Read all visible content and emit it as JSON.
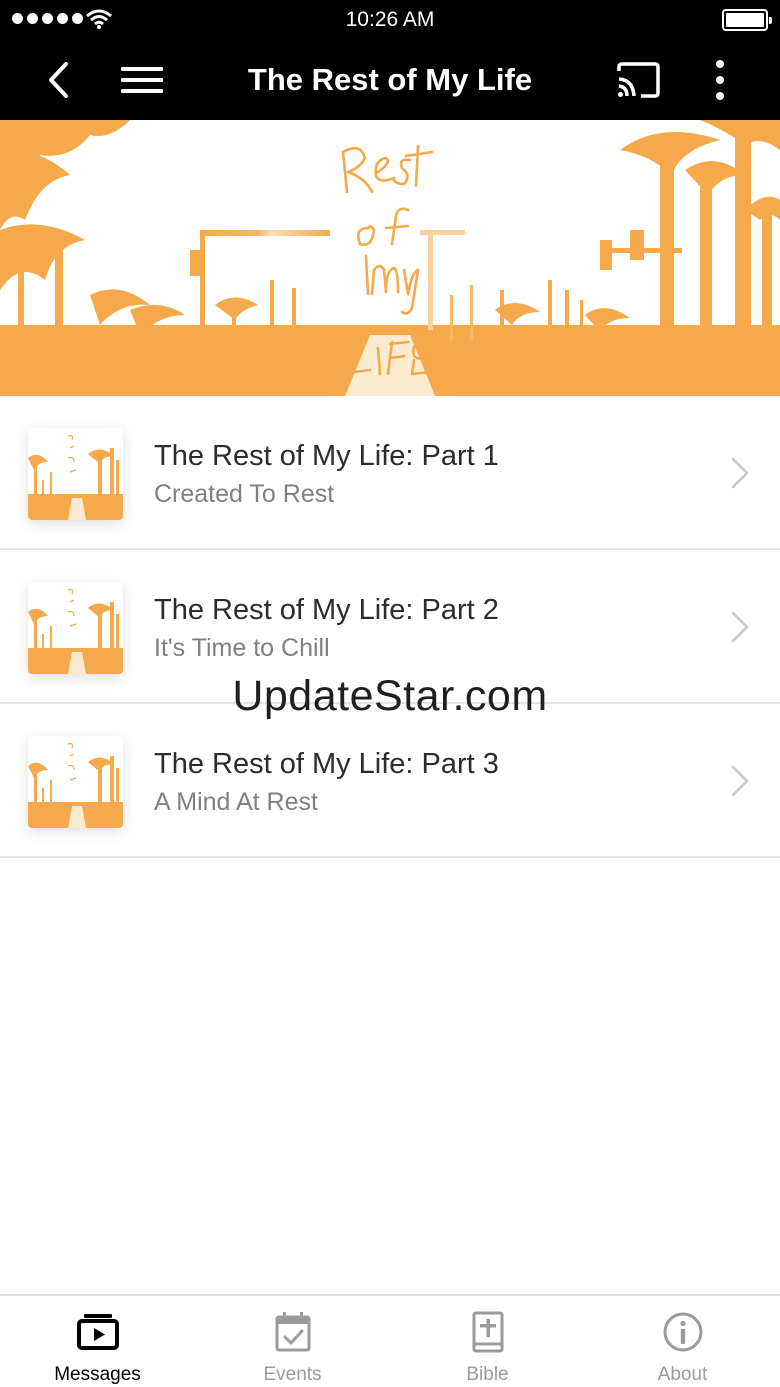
{
  "status_bar": {
    "time": "10:26 AM",
    "signal_icon": "signal-dots-icon",
    "wifi_icon": "wifi-icon",
    "battery_icon": "battery-full-icon"
  },
  "nav": {
    "title": "The Rest of My Life",
    "back_icon": "chevron-left-icon",
    "menu_icon": "hamburger-menu-icon",
    "cast_icon": "cast-icon",
    "more_icon": "more-vertical-icon"
  },
  "banner": {
    "art_text": [
      "Rest",
      "of",
      "My",
      "LIFE"
    ],
    "accent_color": "#F5A94A"
  },
  "list": {
    "items": [
      {
        "title": "The Rest of My Life: Part 1",
        "subtitle": "Created To Rest"
      },
      {
        "title": "The Rest of My Life: Part 2",
        "subtitle": "It's Time to Chill"
      },
      {
        "title": "The Rest of My Life: Part 3",
        "subtitle": "A Mind At Rest"
      }
    ]
  },
  "watermark": "UpdateStar.com",
  "tabs": [
    {
      "label": "Messages",
      "icon": "play-media-icon",
      "active": true
    },
    {
      "label": "Events",
      "icon": "calendar-check-icon",
      "active": false
    },
    {
      "label": "Bible",
      "icon": "bible-cross-icon",
      "active": false
    },
    {
      "label": "About",
      "icon": "info-circle-icon",
      "active": false
    }
  ],
  "colors": {
    "bar_background": "#000000",
    "accent_orange": "#F5A94A",
    "active_tab": "#000000",
    "inactive_tab": "#9B9B9B"
  }
}
